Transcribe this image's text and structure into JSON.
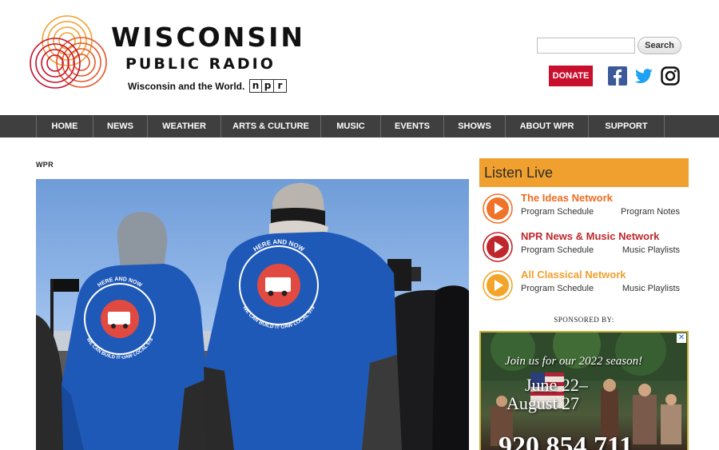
{
  "header": {
    "brand_title": "WISCONSIN",
    "brand_subtitle": "PUBLIC RADIO",
    "tagline": "Wisconsin and the World.",
    "npr_letters": [
      "n",
      "p",
      "r"
    ],
    "brand_colors": {
      "orange": "#f0a02e",
      "red": "#c8102e"
    }
  },
  "search": {
    "value": "",
    "button_label": "Search"
  },
  "donate_label": "DONATE",
  "social": [
    {
      "icon": "facebook-icon",
      "color": "#3b5998"
    },
    {
      "icon": "twitter-icon",
      "color": "#1da1f2"
    },
    {
      "icon": "instagram-icon",
      "color": "#111111"
    }
  ],
  "nav": {
    "items": [
      "HOME",
      "NEWS",
      "WEATHER",
      "ARTS & CULTURE",
      "MUSIC",
      "EVENTS",
      "SHOWS",
      "ABOUT WPR",
      "SUPPORT"
    ]
  },
  "article": {
    "kicker": "WPR",
    "photo_shirt_text": {
      "top": "HERE AND NOW",
      "bottom": "WE CAN BUILD IT·UAW LOCAL 578"
    }
  },
  "listen_live": {
    "title": "Listen Live",
    "stations": [
      {
        "name": "The Ideas Network",
        "link1": "Program Schedule",
        "link2": "Program Notes",
        "color": "#ef6c22",
        "play_color": "#f0732a"
      },
      {
        "name": "NPR News & Music Network",
        "link1": "Program Schedule",
        "link2": "Music Playlists",
        "color": "#c0272d",
        "play_color": "#c0272d"
      },
      {
        "name": "All Classical Network",
        "link1": "Program Schedule",
        "link2": "Music Playlists",
        "color": "#f0a02e",
        "play_color": "#f3a52a"
      }
    ]
  },
  "sponsored_label": "SPONSORED BY:",
  "ad": {
    "headline": "Join us for our 2022 season!",
    "date_line1": "June 22–",
    "date_line2": "August 27",
    "phone": "920.854.711",
    "close_glyph": "✕"
  }
}
